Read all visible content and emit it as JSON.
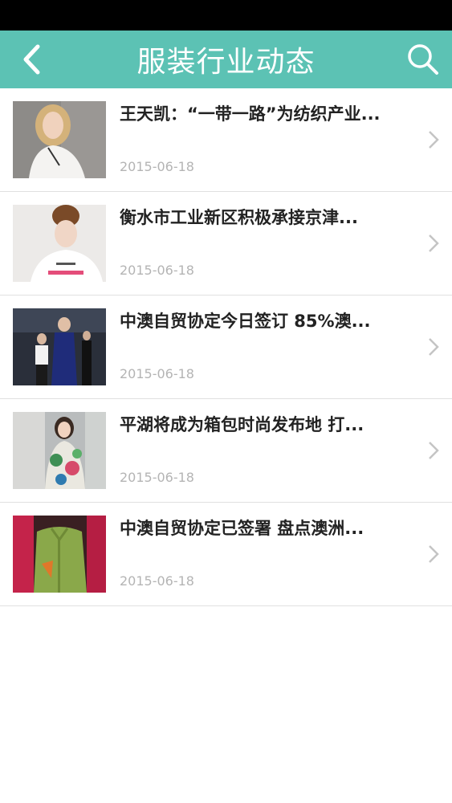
{
  "header": {
    "title": "服装行业动态",
    "background": "#5cc2b4",
    "back_icon": "chevron-left-icon",
    "search_icon": "search-icon"
  },
  "articles": [
    {
      "title": "王天凯：“一带一路”为纺织产业...",
      "date": "2015-06-18",
      "image": "woman-white-top"
    },
    {
      "title": "衡水市工业新区积极承接京津...",
      "date": "2015-06-18",
      "image": "woman-white-tshirt"
    },
    {
      "title": "中澳自贸协定今日签订 85%澳...",
      "date": "2015-06-18",
      "image": "runway-models"
    },
    {
      "title": "平湖将成为箱包时尚发布地 打...",
      "date": "2015-06-18",
      "image": "woman-floral-top"
    },
    {
      "title": "中澳自贸协定已签署 盘点澳洲...",
      "date": "2015-06-18",
      "image": "green-shirt-mannequin"
    }
  ],
  "colors": {
    "status_bar": "#000000",
    "title_text": "#222222",
    "date_text": "#b4b4b4",
    "divider": "#e0e0e0",
    "chevron": "#c4c4c4"
  }
}
